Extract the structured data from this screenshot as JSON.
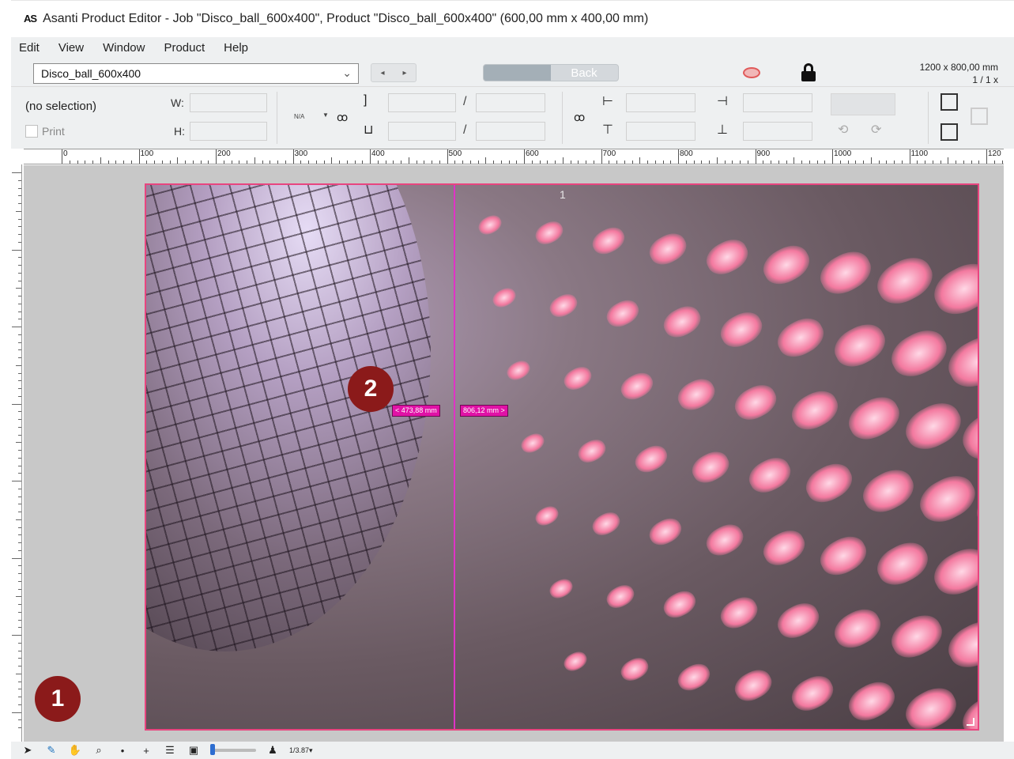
{
  "window": {
    "logo": "AS",
    "title": "Asanti Product Editor - Job \"Disco_ball_600x400\", Product \"Disco_ball_600x400\" (600,00 mm x 400,00 mm)"
  },
  "menu": [
    "Edit",
    "View",
    "Window",
    "Product",
    "Help"
  ],
  "toolbar": {
    "product_name": "Disco_ball_600x400",
    "nav_prev": "◂",
    "nav_next": "▸",
    "back_label": "Back",
    "size_line1": "1200 x 800,00 mm",
    "size_line2": "1 / 1 x"
  },
  "properties": {
    "selection": "(no selection)",
    "print_label": "Print",
    "w_label": "W:",
    "h_label": "H:",
    "na_label": "N/A",
    "slash": "/"
  },
  "ruler": {
    "labels": [
      "0",
      "100",
      "200",
      "300",
      "400",
      "500",
      "600",
      "700",
      "800",
      "900",
      "1000",
      "1100",
      "120"
    ]
  },
  "canvas": {
    "page_number": "1",
    "measure_left": "< 473,88 mm",
    "measure_right": "806,12 mm >",
    "colors": {
      "guide": "#e032c6",
      "page_border": "#e8457f",
      "badge": "#8b1a1a"
    }
  },
  "badges": [
    "1",
    "2"
  ],
  "bottom_tools": {
    "icons": [
      "arrow-pointer-icon",
      "pen-icon",
      "hand-icon",
      "zoom-icon",
      "point-icon",
      "crosshair-icon",
      "sliders-icon",
      "fit-icon",
      "person-icon"
    ],
    "zoom_level": "1/3.87▾"
  }
}
